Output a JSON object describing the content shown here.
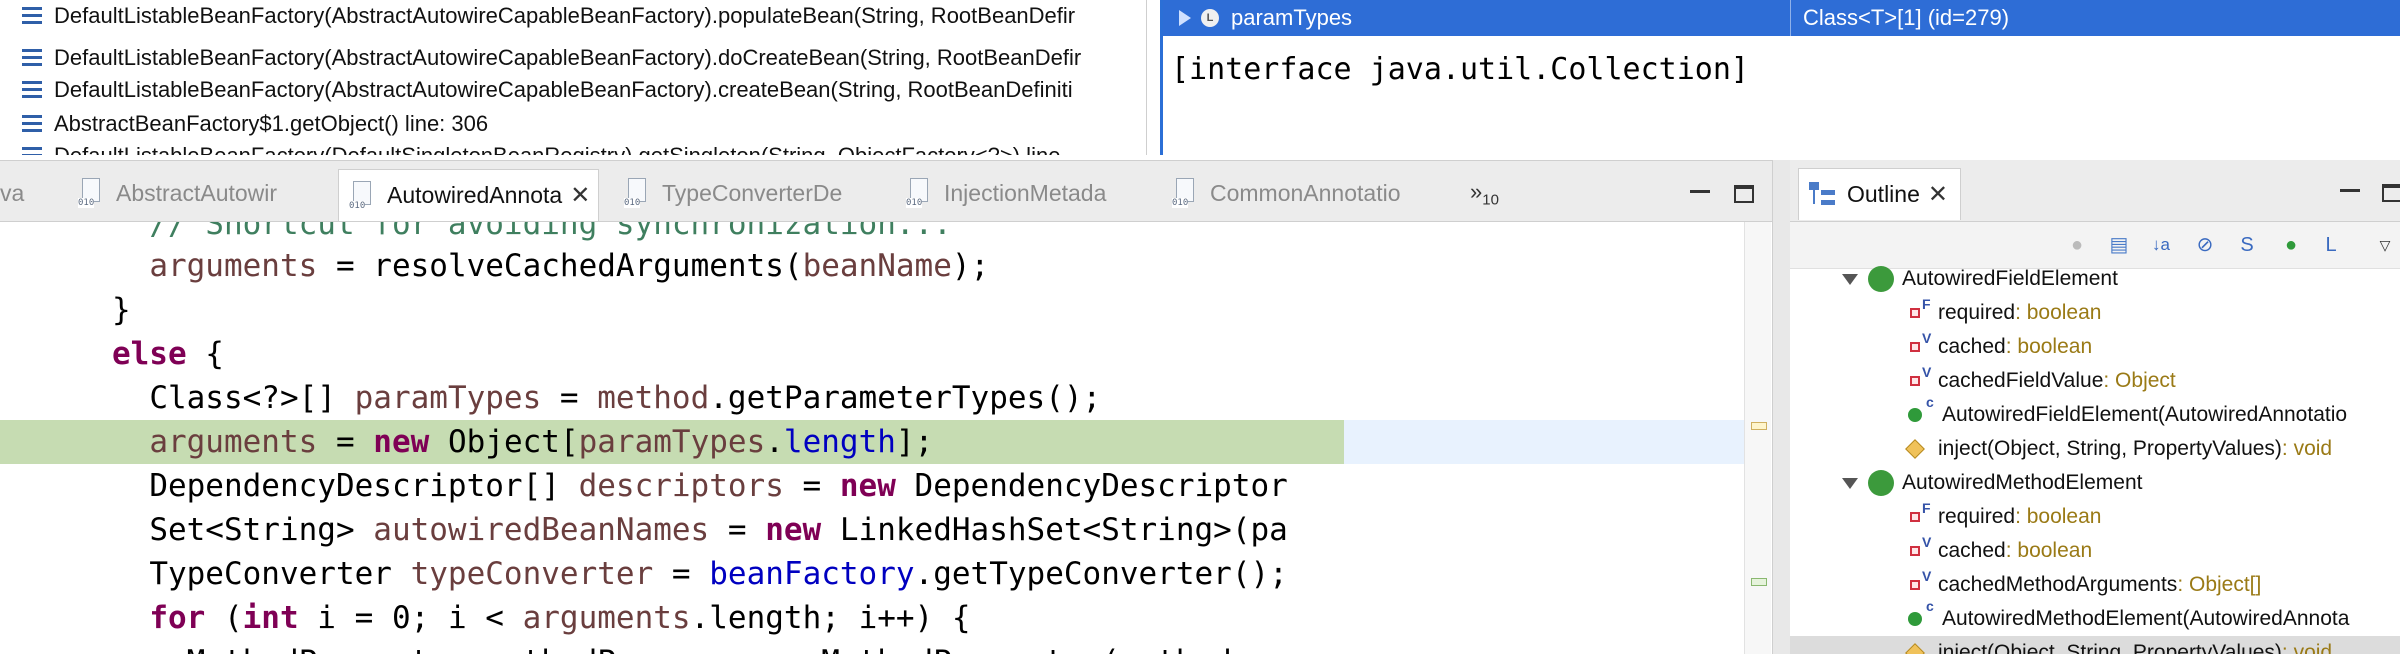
{
  "debug": {
    "stack_frames": [
      "DefaultListableBeanFactory(AbstractAutowireCapableBeanFactory).populateBean(String, RootBeanDefir",
      "DefaultListableBeanFactory(AbstractAutowireCapableBeanFactory).doCreateBean(String, RootBeanDefir",
      "DefaultListableBeanFactory(AbstractAutowireCapableBeanFactory).createBean(String, RootBeanDefiniti",
      "AbstractBeanFactory$1.getObject() line: 306",
      "DefaultListableBeanFactory(DefaultSingletonBeanRegistry).getSingleton(String, ObjectFactory<?>) line"
    ],
    "variable": {
      "name": "paramTypes",
      "value": "Class<T>[1]  (id=279)",
      "badge": "L"
    },
    "detail": "[interface java.util.Collection]"
  },
  "tabs": [
    {
      "label": "va",
      "active": false
    },
    {
      "label": "AbstractAutowir",
      "active": false
    },
    {
      "label": "AutowiredAnnota",
      "active": true
    },
    {
      "label": "TypeConverterDe",
      "active": false
    },
    {
      "label": "InjectionMetada",
      "active": false
    },
    {
      "label": "CommonAnnotatio",
      "active": false
    }
  ],
  "more_tabs": {
    "glyph": "»",
    "count": "10"
  },
  "icons": {
    "file_bits": "010",
    "close": "✕"
  },
  "code": {
    "l1_comment": "// Shortcut for avoiding synchronization...",
    "l2_var": "arguments",
    "l2_rest": " = resolveCachedArguments(",
    "l2_arg": "beanName",
    "l2_end": ");",
    "l3": "}",
    "l4_kw": "else",
    "l4_rest": " {",
    "l5_type": "Class<?>[] ",
    "l5_var": "paramTypes",
    "l5_mid": " = ",
    "l5_var2": "method",
    "l5_end": ".getParameterTypes();",
    "l6_var": "arguments",
    "l6_mid": " = ",
    "l6_kw": "new",
    "l6_obj": " Object[",
    "l6_var2": "paramTypes",
    "l6_dot": ".",
    "l6_fld": "length",
    "l6_end": "];",
    "l7_type": "DependencyDescriptor[] ",
    "l7_var": "descriptors",
    "l7_mid": " = ",
    "l7_kw": "new",
    "l7_end": " DependencyDescriptor",
    "l8_type": "Set<String> ",
    "l8_var": "autowiredBeanNames",
    "l8_mid": " = ",
    "l8_kw": "new",
    "l8_end": " LinkedHashSet<String>(pa",
    "l9_type": "TypeConverter ",
    "l9_var": "typeConverter",
    "l9_mid": " = ",
    "l9_fld": "beanFactory",
    "l9_end": ".getTypeConverter();",
    "l10_kw": "for",
    "l10_a": " (",
    "l10_kw2": "int",
    "l10_b": " i = 0; i < ",
    "l10_var": "arguments",
    "l10_c": ".length; i++) {",
    "l11": "MethodParameter methodParam = new MethodParameter(method,"
  },
  "outline": {
    "title": "Outline",
    "items": [
      {
        "kind": "class",
        "name": "AutowiredFieldElement",
        "type": ""
      },
      {
        "kind": "field",
        "mod": "F",
        "name": "required",
        "type": " : boolean"
      },
      {
        "kind": "field",
        "mod": "V",
        "name": "cached",
        "type": " : boolean"
      },
      {
        "kind": "field",
        "mod": "V",
        "name": "cachedFieldValue",
        "type": " : Object"
      },
      {
        "kind": "ctor",
        "mod": "c",
        "name": "AutowiredFieldElement(AutowiredAnnotatio",
        "type": ""
      },
      {
        "kind": "method-pkg",
        "name": "inject(Object, String, PropertyValues)",
        "type": " : void"
      },
      {
        "kind": "class",
        "name": "AutowiredMethodElement",
        "type": ""
      },
      {
        "kind": "field",
        "mod": "F",
        "name": "required",
        "type": " : boolean"
      },
      {
        "kind": "field",
        "mod": "V",
        "name": "cached",
        "type": " : boolean"
      },
      {
        "kind": "field",
        "mod": "V",
        "name": "cachedMethodArguments",
        "type": " : Object[]"
      },
      {
        "kind": "ctor",
        "mod": "c",
        "name": "AutowiredMethodElement(AutowiredAnnota",
        "type": ""
      },
      {
        "kind": "method-pkg",
        "name": "inject(Object, String, PropertyValues)",
        "type": " : void"
      }
    ]
  },
  "colors": {
    "selection": "#2e6dd6",
    "keyword": "#7f0055",
    "field": "#0000c0",
    "highlight": "#c6dcb2"
  }
}
